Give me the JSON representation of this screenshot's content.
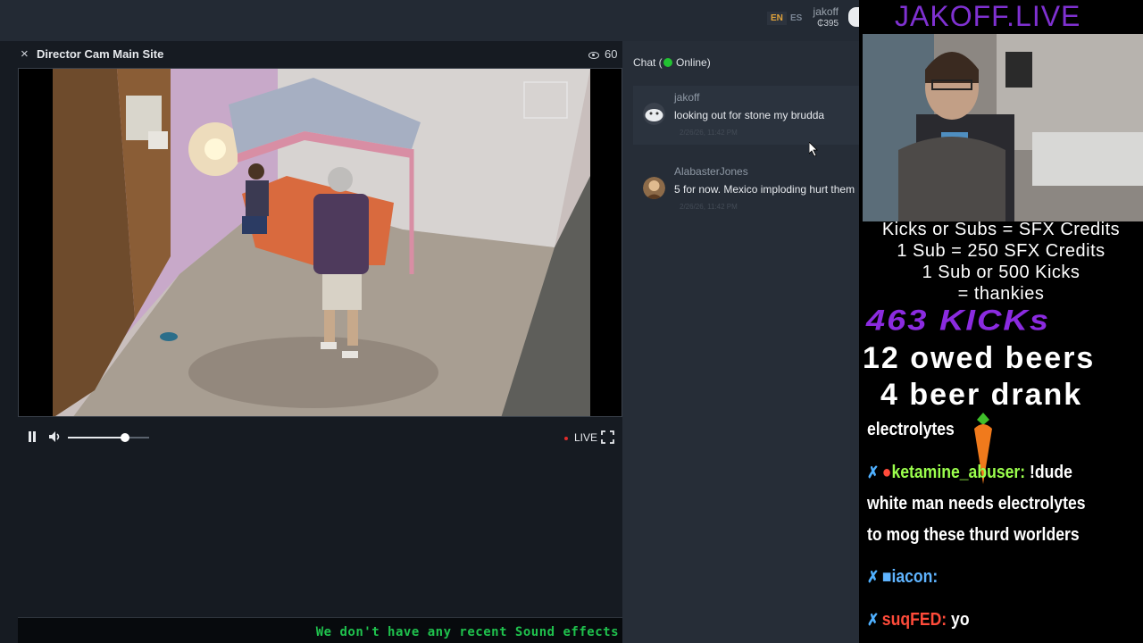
{
  "topbar": {
    "lang_en": "EN",
    "lang_es": "ES",
    "username": "jakoff",
    "credits": "₵395",
    "avatar_icon": "user-avatar-icon"
  },
  "cam": {
    "close_glyph": "×",
    "title": "Director Cam Main Site",
    "viewer_count": "60",
    "eye_icon": "eye-icon"
  },
  "player": {
    "volume": 0.7,
    "live_label": "LIVE",
    "icons": [
      "pause-icon",
      "volume-icon",
      "fullscreen-icon"
    ]
  },
  "ticker": {
    "text": "We don't have any recent Sound effects"
  },
  "chat": {
    "title_prefix": "Chat (",
    "status": "Online)",
    "status_color": "#22c232",
    "messages": [
      {
        "user": "jakoff",
        "text": "looking out for stone my brudda",
        "time": "2/26/26, 11:42 PM"
      },
      {
        "user": "AlabasterJones",
        "text": "5 for now. Mexico imploding hurt them",
        "time": "2/26/26, 11:42 PM"
      }
    ]
  },
  "overlay": {
    "title": "JAKOFF.LIVE",
    "rules": [
      "Kicks or Subs = SFX Credits",
      "1 Sub = 250 SFX Credits",
      "1 Sub or 500 Kicks",
      "= thankies"
    ],
    "kicks": "463 KICKs",
    "owed_beers": "12 owed beers",
    "beer_drank": "4 beer drank",
    "chat_lines": [
      {
        "text": "electrolytes"
      },
      {
        "user": "ketamine_abuser:",
        "text": " !dude"
      },
      {
        "text": "white man needs electrolytes"
      },
      {
        "text": "to mog these thurd worlders"
      },
      {
        "user": "iacon:",
        "text": ""
      },
      {
        "user": "suqFED:",
        "text": " yo"
      }
    ],
    "accent_purple": "#7f31d1",
    "name_green": "#9bff4d"
  }
}
